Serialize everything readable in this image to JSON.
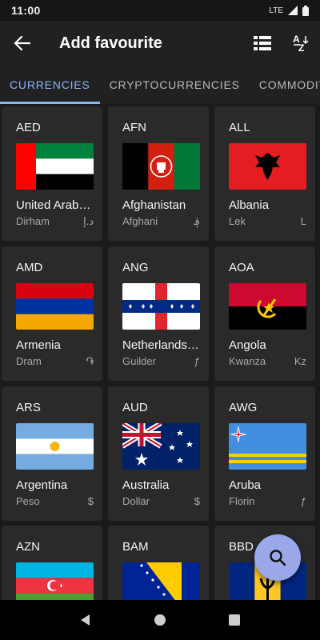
{
  "status": {
    "time": "11:00",
    "network": "LTE"
  },
  "header": {
    "title": "Add favourite"
  },
  "tabs": [
    "CURRENCIES",
    "CRYPTOCURRENCIES",
    "COMMODITIES"
  ],
  "currencies": [
    {
      "code": "AED",
      "country": "United Arab Emirates",
      "name": "Dirham",
      "symbol": "د.إ"
    },
    {
      "code": "AFN",
      "country": "Afghanistan",
      "name": "Afghani",
      "symbol": "؋"
    },
    {
      "code": "ALL",
      "country": "Albania",
      "name": "Lek",
      "symbol": "L"
    },
    {
      "code": "AMD",
      "country": "Armenia",
      "name": "Dram",
      "symbol": "֏"
    },
    {
      "code": "ANG",
      "country": "Netherlands Antilles",
      "name": "Guilder",
      "symbol": "ƒ"
    },
    {
      "code": "AOA",
      "country": "Angola",
      "name": "Kwanza",
      "symbol": "Kz"
    },
    {
      "code": "ARS",
      "country": "Argentina",
      "name": "Peso",
      "symbol": "$"
    },
    {
      "code": "AUD",
      "country": "Australia",
      "name": "Dollar",
      "symbol": "$"
    },
    {
      "code": "AWG",
      "country": "Aruba",
      "name": "Florin",
      "symbol": "ƒ"
    },
    {
      "code": "AZN",
      "country": "",
      "name": "",
      "symbol": ""
    },
    {
      "code": "BAM",
      "country": "",
      "name": "",
      "symbol": ""
    },
    {
      "code": "BBD",
      "country": "",
      "name": "",
      "symbol": ""
    }
  ],
  "icons": {
    "back": "arrow-back-icon",
    "view": "list-view-icon",
    "sort": "sort-az-icon",
    "search": "search-icon"
  },
  "colors": {
    "accent": "#8ab4f8",
    "fab": "#9aa7e8"
  }
}
